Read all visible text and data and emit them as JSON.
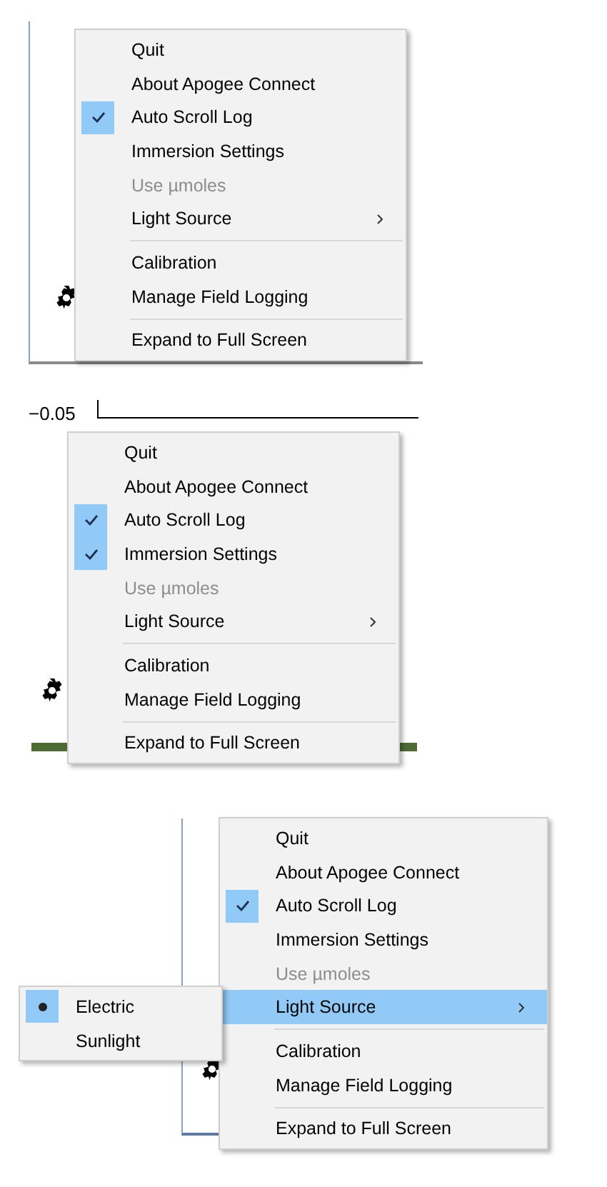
{
  "panels": [
    {
      "menu": [
        {
          "kind": "item",
          "label": "Quit",
          "checked": false,
          "disabled": false,
          "submenu": false,
          "highlighted": false
        },
        {
          "kind": "item",
          "label": "About Apogee Connect",
          "checked": false,
          "disabled": false,
          "submenu": false,
          "highlighted": false
        },
        {
          "kind": "item",
          "label": "Auto Scroll Log",
          "checked": true,
          "disabled": false,
          "submenu": false,
          "highlighted": false
        },
        {
          "kind": "item",
          "label": "Immersion Settings",
          "checked": false,
          "disabled": false,
          "submenu": false,
          "highlighted": false
        },
        {
          "kind": "item",
          "label": "Use µmoles",
          "checked": false,
          "disabled": true,
          "submenu": false,
          "highlighted": false
        },
        {
          "kind": "item",
          "label": "Light Source",
          "checked": false,
          "disabled": false,
          "submenu": true,
          "highlighted": false
        },
        {
          "kind": "separator"
        },
        {
          "kind": "item",
          "label": "Calibration",
          "checked": false,
          "disabled": false,
          "submenu": false,
          "highlighted": false
        },
        {
          "kind": "item",
          "label": "Manage Field Logging",
          "checked": false,
          "disabled": false,
          "submenu": false,
          "highlighted": false
        },
        {
          "kind": "separator"
        },
        {
          "kind": "item",
          "label": "Expand to Full Screen",
          "checked": false,
          "disabled": false,
          "submenu": false,
          "highlighted": false
        }
      ]
    },
    {
      "axis_label": "−0.05",
      "menu": [
        {
          "kind": "item",
          "label": "Quit",
          "checked": false,
          "disabled": false,
          "submenu": false,
          "highlighted": false
        },
        {
          "kind": "item",
          "label": "About Apogee Connect",
          "checked": false,
          "disabled": false,
          "submenu": false,
          "highlighted": false
        },
        {
          "kind": "item",
          "label": "Auto Scroll Log",
          "checked": true,
          "disabled": false,
          "submenu": false,
          "highlighted": false
        },
        {
          "kind": "item",
          "label": "Immersion Settings",
          "checked": true,
          "disabled": false,
          "submenu": false,
          "highlighted": false
        },
        {
          "kind": "item",
          "label": "Use µmoles",
          "checked": false,
          "disabled": true,
          "submenu": false,
          "highlighted": false
        },
        {
          "kind": "item",
          "label": "Light Source",
          "checked": false,
          "disabled": false,
          "submenu": true,
          "highlighted": false
        },
        {
          "kind": "separator"
        },
        {
          "kind": "item",
          "label": "Calibration",
          "checked": false,
          "disabled": false,
          "submenu": false,
          "highlighted": false
        },
        {
          "kind": "item",
          "label": "Manage Field Logging",
          "checked": false,
          "disabled": false,
          "submenu": false,
          "highlighted": false
        },
        {
          "kind": "separator"
        },
        {
          "kind": "item",
          "label": "Expand to Full Screen",
          "checked": false,
          "disabled": false,
          "submenu": false,
          "highlighted": false
        }
      ]
    },
    {
      "menu": [
        {
          "kind": "item",
          "label": "Quit",
          "checked": false,
          "disabled": false,
          "submenu": false,
          "highlighted": false
        },
        {
          "kind": "item",
          "label": "About Apogee Connect",
          "checked": false,
          "disabled": false,
          "submenu": false,
          "highlighted": false
        },
        {
          "kind": "item",
          "label": "Auto Scroll Log",
          "checked": true,
          "disabled": false,
          "submenu": false,
          "highlighted": false
        },
        {
          "kind": "item",
          "label": "Immersion Settings",
          "checked": false,
          "disabled": false,
          "submenu": false,
          "highlighted": false
        },
        {
          "kind": "item",
          "label": "Use µmoles",
          "checked": false,
          "disabled": true,
          "submenu": false,
          "highlighted": false
        },
        {
          "kind": "item",
          "label": "Light Source",
          "checked": false,
          "disabled": false,
          "submenu": true,
          "highlighted": true
        },
        {
          "kind": "separator"
        },
        {
          "kind": "item",
          "label": "Calibration",
          "checked": false,
          "disabled": false,
          "submenu": false,
          "highlighted": false
        },
        {
          "kind": "item",
          "label": "Manage Field Logging",
          "checked": false,
          "disabled": false,
          "submenu": false,
          "highlighted": false
        },
        {
          "kind": "separator"
        },
        {
          "kind": "item",
          "label": "Expand to Full Screen",
          "checked": false,
          "disabled": false,
          "submenu": false,
          "highlighted": false
        }
      ],
      "submenu": [
        {
          "label": "Electric",
          "selected": true
        },
        {
          "label": "Sunlight",
          "selected": false
        }
      ]
    }
  ]
}
